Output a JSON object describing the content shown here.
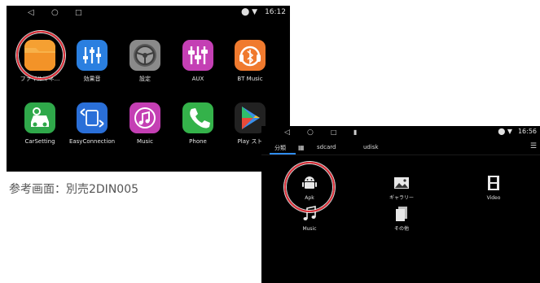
{
  "screen1": {
    "status": {
      "time": "16:12",
      "sys_icons": "location-wifi"
    },
    "apps": [
      {
        "label": "ファイルマネ...",
        "icon": "folder-icon",
        "color": "#f39a2e"
      },
      {
        "label": "効果音",
        "icon": "equalizer-icon",
        "color": "#2a7fe0"
      },
      {
        "label": "設定",
        "icon": "steering-gear-icon",
        "color": "#8c8c8c"
      },
      {
        "label": "AUX",
        "icon": "aux-sliders-icon",
        "color": "#c43fb4"
      },
      {
        "label": "BT Music",
        "icon": "bluetooth-music-icon",
        "color": "#f07a2e"
      },
      {
        "label": "CarSetting",
        "icon": "car-settings-icon",
        "color": "#2fa84a"
      },
      {
        "label": "EasyConnection",
        "icon": "easyconnection-icon",
        "color": "#2a6fd8"
      },
      {
        "label": "Music",
        "icon": "music-note-icon",
        "color": "#c43fb4"
      },
      {
        "label": "Phone",
        "icon": "phone-icon",
        "color": "#34b24a"
      },
      {
        "label": "Play スト",
        "icon": "play-store-icon",
        "color": "#3a8fe8"
      }
    ]
  },
  "caption": "参考画面：別売2DIN005",
  "screen2": {
    "status": {
      "time": "16:56",
      "sys_icons": "location-wifi"
    },
    "tabs": [
      "分類",
      "sdcard",
      "udisk"
    ],
    "items": [
      {
        "label": "Apk",
        "icon": "android-icon"
      },
      {
        "label": "ギャラリー",
        "icon": "gallery-icon"
      },
      {
        "label": "Video",
        "icon": "film-icon"
      },
      {
        "label": "Music",
        "icon": "music-icon"
      },
      {
        "label": "その他",
        "icon": "other-files-icon"
      }
    ]
  }
}
